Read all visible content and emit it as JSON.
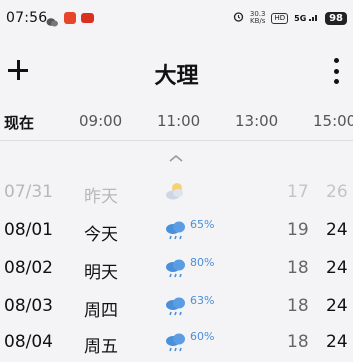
{
  "status": {
    "time": "07:56",
    "network_speed_top": "30.3",
    "network_speed_bottom": "KB/s",
    "hd_badge": "HD",
    "signal": "5G",
    "battery": "98"
  },
  "header": {
    "title": "大理"
  },
  "hours": {
    "now": "现在",
    "items": [
      "09:00",
      "11:00",
      "13:00",
      "15:00"
    ]
  },
  "days": [
    {
      "date": "07/31",
      "day": "昨天",
      "icon": "partly-cloudy-icon",
      "pop": "",
      "low": "17",
      "high": "26"
    },
    {
      "date": "08/01",
      "day": "今天",
      "icon": "rain-icon",
      "pop": "65%",
      "low": "19",
      "high": "24"
    },
    {
      "date": "08/02",
      "day": "明天",
      "icon": "rain-icon",
      "pop": "80%",
      "low": "18",
      "high": "24"
    },
    {
      "date": "08/03",
      "day": "周四",
      "icon": "rain-icon",
      "pop": "63%",
      "low": "18",
      "high": "24"
    },
    {
      "date": "08/04",
      "day": "周五",
      "icon": "rain-icon",
      "pop": "60%",
      "low": "18",
      "high": "24"
    }
  ],
  "colors": {
    "rain_blue": "#4a90d9",
    "sun_yellow": "#f5c342"
  }
}
